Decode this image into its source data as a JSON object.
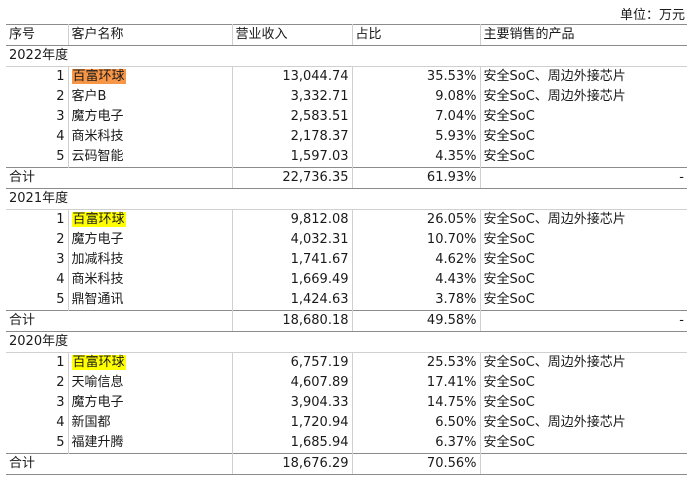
{
  "unit_label": "单位：万元",
  "header": [
    "序号",
    "客户名称",
    "营业收入",
    "占比",
    "主要销售的产品"
  ],
  "sections": [
    {
      "year": "2022年度",
      "rows": [
        {
          "no": "1",
          "name": "百富环球",
          "revenue": "13,044.74",
          "share": "35.53%",
          "product": "安全SoC、周边外接芯片",
          "highlight": "orange"
        },
        {
          "no": "2",
          "name": "客户B",
          "revenue": "3,332.71",
          "share": "9.08%",
          "product": "安全SoC、周边外接芯片",
          "highlight": ""
        },
        {
          "no": "3",
          "name": "魔方电子",
          "revenue": "2,583.51",
          "share": "7.04%",
          "product": "安全SoC",
          "highlight": ""
        },
        {
          "no": "4",
          "name": "商米科技",
          "revenue": "2,178.37",
          "share": "5.93%",
          "product": "安全SoC",
          "highlight": ""
        },
        {
          "no": "5",
          "name": "云码智能",
          "revenue": "1,597.03",
          "share": "4.35%",
          "product": "安全SoC",
          "highlight": ""
        }
      ],
      "total": {
        "label": "合计",
        "revenue": "22,736.35",
        "share": "61.93%",
        "product": "-"
      }
    },
    {
      "year": "2021年度",
      "rows": [
        {
          "no": "1",
          "name": "百富环球",
          "revenue": "9,812.08",
          "share": "26.05%",
          "product": "安全SoC、周边外接芯片",
          "highlight": "yellow"
        },
        {
          "no": "2",
          "name": "魔方电子",
          "revenue": "4,032.31",
          "share": "10.70%",
          "product": "安全SoC",
          "highlight": ""
        },
        {
          "no": "3",
          "name": "加减科技",
          "revenue": "1,741.67",
          "share": "4.62%",
          "product": "安全SoC",
          "highlight": ""
        },
        {
          "no": "4",
          "name": "商米科技",
          "revenue": "1,669.49",
          "share": "4.43%",
          "product": "安全SoC",
          "highlight": ""
        },
        {
          "no": "5",
          "name": "鼎智通讯",
          "revenue": "1,424.63",
          "share": "3.78%",
          "product": "安全SoC",
          "highlight": ""
        }
      ],
      "total": {
        "label": "合计",
        "revenue": "18,680.18",
        "share": "49.58%",
        "product": "-"
      }
    },
    {
      "year": "2020年度",
      "rows": [
        {
          "no": "1",
          "name": "百富环球",
          "revenue": "6,757.19",
          "share": "25.53%",
          "product": "安全SoC、周边外接芯片",
          "highlight": "yellow"
        },
        {
          "no": "2",
          "name": "天喻信息",
          "revenue": "4,607.89",
          "share": "17.41%",
          "product": "安全SoC",
          "highlight": ""
        },
        {
          "no": "3",
          "name": "魔方电子",
          "revenue": "3,904.33",
          "share": "14.75%",
          "product": "安全SoC",
          "highlight": ""
        },
        {
          "no": "4",
          "name": "新国都",
          "revenue": "1,720.94",
          "share": "6.50%",
          "product": "安全SoC、周边外接芯片",
          "highlight": ""
        },
        {
          "no": "5",
          "name": "福建升腾",
          "revenue": "1,685.94",
          "share": "6.37%",
          "product": "安全SoC",
          "highlight": ""
        }
      ],
      "total": {
        "label": "合计",
        "revenue": "18,676.29",
        "share": "70.56%",
        "product": ""
      }
    }
  ]
}
